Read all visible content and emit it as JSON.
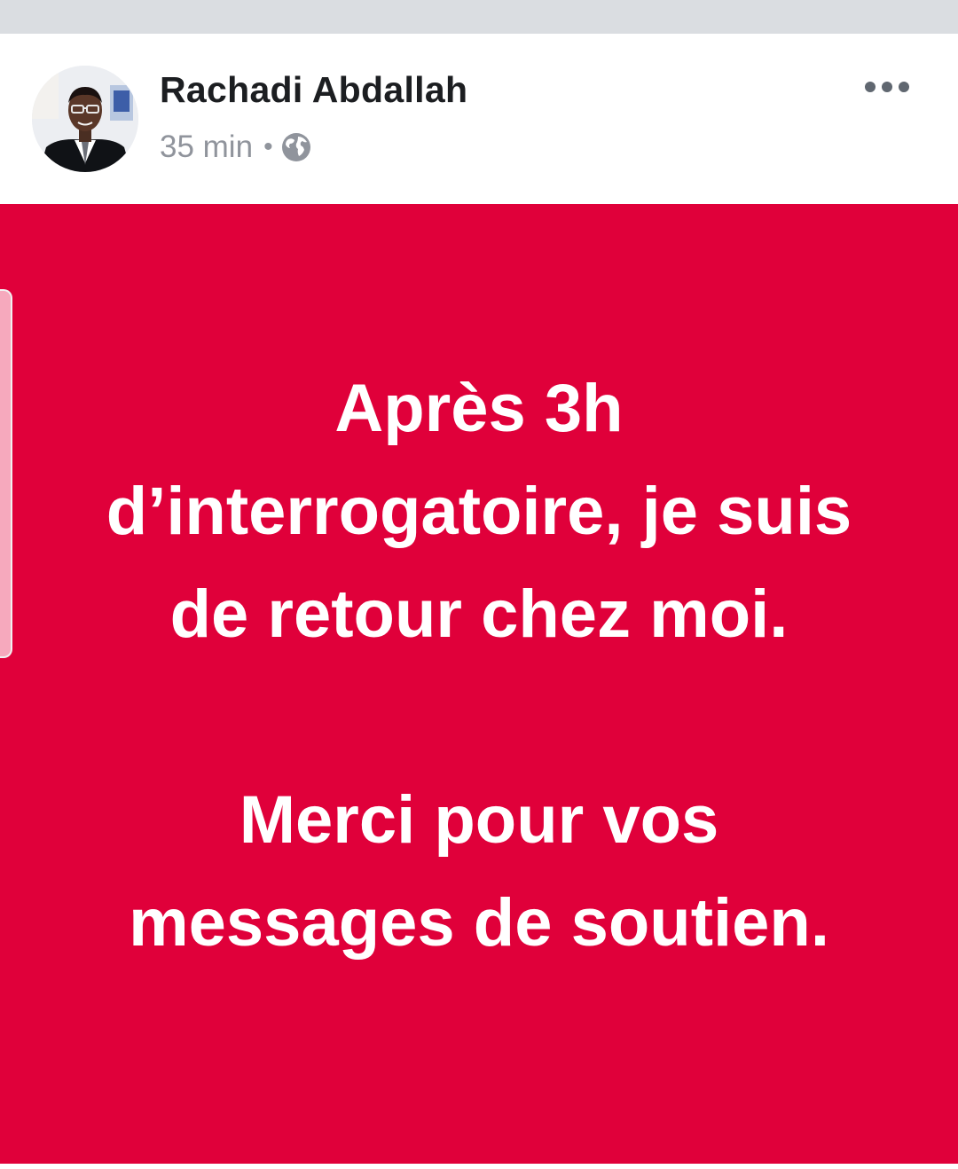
{
  "post": {
    "author_name": "Rachadi Abdallah",
    "time": "35 min",
    "separator": "•",
    "audience_icon": "globe-icon",
    "more_icon": "more-options-icon",
    "background_color": "#e0003a",
    "status_paragraphs": [
      "Après 3h d’interrogatoire, je suis de retour chez moi.",
      "Merci pour vos messages de soutien."
    ]
  }
}
